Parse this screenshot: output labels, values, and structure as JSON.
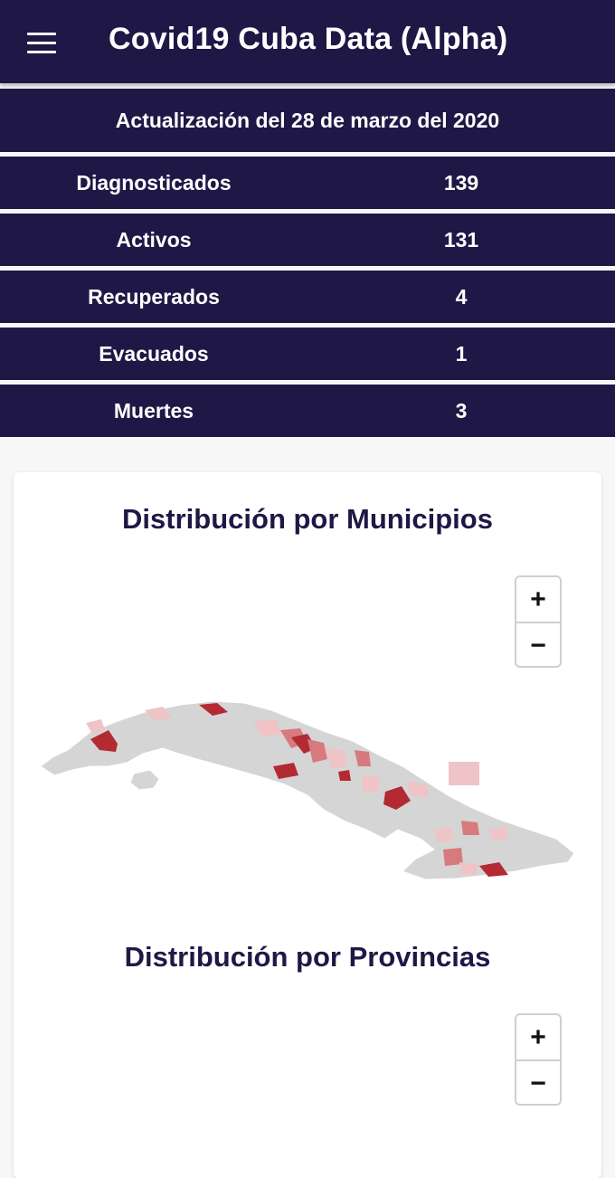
{
  "app": {
    "title": "Covid19 Cuba Data (Alpha)"
  },
  "update": {
    "label": "Actualización del 28 de marzo del 2020"
  },
  "stats": [
    {
      "label": "Diagnosticados",
      "value": "139"
    },
    {
      "label": "Activos",
      "value": "131"
    },
    {
      "label": "Recuperados",
      "value": "4"
    },
    {
      "label": "Evacuados",
      "value": "1"
    },
    {
      "label": "Muertes",
      "value": "3"
    }
  ],
  "maps": {
    "municipios": {
      "title": "Distribución por Municipios",
      "zoom_in": "+",
      "zoom_out": "−"
    },
    "provincias": {
      "title": "Distribución por Provincias",
      "zoom_in": "+",
      "zoom_out": "−"
    }
  },
  "colors": {
    "header_bg": "#1f1846",
    "map_base": "#d5d5d5",
    "map_light": "#efc4c6",
    "map_medium": "#d77a7e",
    "map_dark": "#b32a33"
  }
}
